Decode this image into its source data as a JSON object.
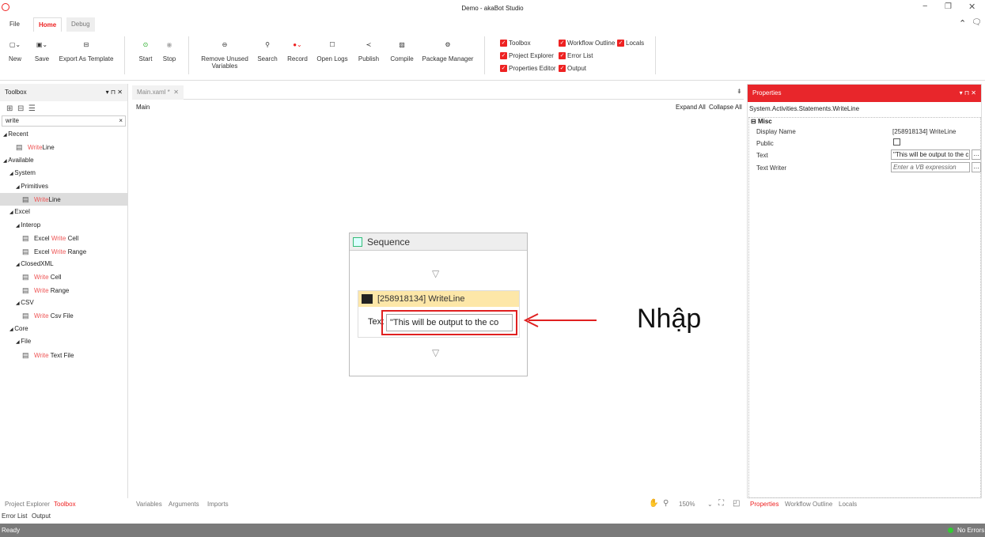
{
  "window": {
    "title": "Demo - akaBot Studio"
  },
  "menu_tabs": [
    "File",
    "Home",
    "Debug"
  ],
  "ribbon": {
    "new": "New",
    "save": "Save",
    "export_template": "Export As Template",
    "start": "Start",
    "stop": "Stop",
    "remove_unused": "Remove Unused Variables",
    "search": "Search",
    "record": "Record",
    "open_logs": "Open Logs",
    "publish": "Publish",
    "compile": "Compile",
    "package_manager": "Package Manager"
  },
  "view_checks": [
    "Toolbox",
    "Workflow Outline",
    "Locals",
    "Project Explorer",
    "Error List",
    "Properties Editor",
    "Output"
  ],
  "toolbox": {
    "title": "Toolbox",
    "pin": "▾ ⊓ ✕",
    "search_value": "write",
    "clear": "×",
    "items": [
      {
        "label_prefix": "",
        "label_hl": "",
        "label_rest": "Recent",
        "level": 0,
        "type": "group"
      },
      {
        "label_prefix": "",
        "label_hl": "Write",
        "label_rest": "Line",
        "level": 2,
        "type": "item"
      },
      {
        "label_prefix": "",
        "label_hl": "",
        "label_rest": "Available",
        "level": 0,
        "type": "group"
      },
      {
        "label_prefix": "",
        "label_hl": "",
        "label_rest": "System",
        "level": 1,
        "type": "group"
      },
      {
        "label_prefix": "",
        "label_hl": "",
        "label_rest": "Primitives",
        "level": 2,
        "type": "group"
      },
      {
        "label_prefix": "",
        "label_hl": "Write",
        "label_rest": "Line",
        "level": 3,
        "type": "item",
        "selected": true
      },
      {
        "label_prefix": "",
        "label_hl": "",
        "label_rest": "Excel",
        "level": 1,
        "type": "group"
      },
      {
        "label_prefix": "",
        "label_hl": "",
        "label_rest": "Interop",
        "level": 2,
        "type": "group"
      },
      {
        "label_prefix": "Excel ",
        "label_hl": "Write",
        "label_rest": " Cell",
        "level": 3,
        "type": "item"
      },
      {
        "label_prefix": "Excel ",
        "label_hl": "Write",
        "label_rest": " Range",
        "level": 3,
        "type": "item"
      },
      {
        "label_prefix": "",
        "label_hl": "",
        "label_rest": "ClosedXML",
        "level": 2,
        "type": "group"
      },
      {
        "label_prefix": "",
        "label_hl": "Write",
        "label_rest": " Cell",
        "level": 3,
        "type": "item"
      },
      {
        "label_prefix": "",
        "label_hl": "Write",
        "label_rest": " Range",
        "level": 3,
        "type": "item"
      },
      {
        "label_prefix": "",
        "label_hl": "",
        "label_rest": "CSV",
        "level": 2,
        "type": "group"
      },
      {
        "label_prefix": "",
        "label_hl": "Write",
        "label_rest": " Csv File",
        "level": 3,
        "type": "item"
      },
      {
        "label_prefix": "",
        "label_hl": "",
        "label_rest": "Core",
        "level": 1,
        "type": "group"
      },
      {
        "label_prefix": "",
        "label_hl": "",
        "label_rest": "File",
        "level": 2,
        "type": "group"
      },
      {
        "label_prefix": "",
        "label_hl": "Write",
        "label_rest": " Text File",
        "level": 3,
        "type": "item"
      }
    ]
  },
  "doc": {
    "tab": "Main.xaml *",
    "breadcrumb": "Main",
    "expand_all": "Expand All",
    "collapse_all": "Collapse All"
  },
  "designer": {
    "sequence": "Sequence",
    "activity": "[258918134] WriteLine",
    "text_label": "Text",
    "text_value": "\"This will be output to the co",
    "annotation": "Nhập"
  },
  "properties": {
    "title": "Properties",
    "pin": "▾ ⊓ ✕",
    "type": "System.Activities.Statements.WriteLine",
    "category": "Misc",
    "rows": [
      {
        "name": "Display Name",
        "value": "[258918134] WriteLine"
      },
      {
        "name": "Public",
        "value": ""
      },
      {
        "name": "Text",
        "value": "\"This will be output to the c"
      },
      {
        "name": "Text Writer",
        "value": "Enter a VB expression"
      }
    ]
  },
  "bottom_left_tabs": [
    "Project Explorer",
    "Toolbox",
    "Error List",
    "Output"
  ],
  "designer_tabs": [
    "Variables",
    "Arguments",
    "Imports"
  ],
  "zoom": "150%",
  "props_tabs": [
    "Properties",
    "Workflow Outline",
    "Locals"
  ],
  "status": {
    "left": "Ready",
    "right": "No Errors"
  },
  "accent": "#e8262b"
}
